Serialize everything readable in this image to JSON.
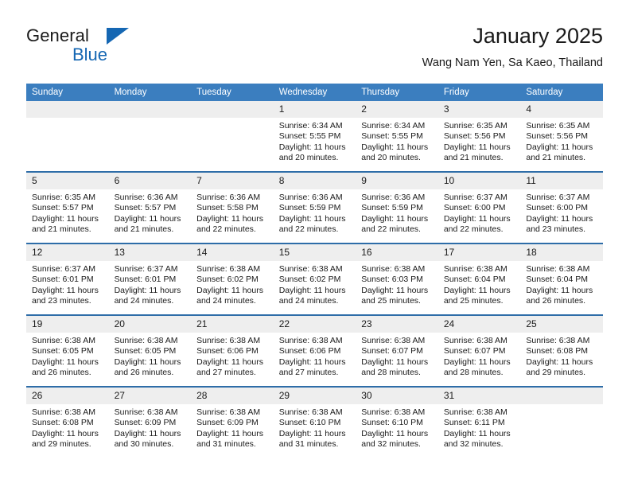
{
  "brand": {
    "name_part1": "General",
    "name_part2": "Blue",
    "logo_icon": "triangle-icon",
    "accent_color": "#1567b3"
  },
  "header": {
    "title": "January 2025",
    "subtitle": "Wang Nam Yen, Sa Kaeo, Thailand"
  },
  "calendar": {
    "header_bg": "#3b7ebf",
    "separator_color": "#2e6da8",
    "daynum_bg": "#eeeeee",
    "weekday_headers": [
      "Sunday",
      "Monday",
      "Tuesday",
      "Wednesday",
      "Thursday",
      "Friday",
      "Saturday"
    ],
    "weeks": [
      [
        {
          "day": "",
          "sunrise": "",
          "sunset": "",
          "daylight_line1": "",
          "daylight_line2": ""
        },
        {
          "day": "",
          "sunrise": "",
          "sunset": "",
          "daylight_line1": "",
          "daylight_line2": ""
        },
        {
          "day": "",
          "sunrise": "",
          "sunset": "",
          "daylight_line1": "",
          "daylight_line2": ""
        },
        {
          "day": "1",
          "sunrise": "Sunrise: 6:34 AM",
          "sunset": "Sunset: 5:55 PM",
          "daylight_line1": "Daylight: 11 hours",
          "daylight_line2": "and 20 minutes."
        },
        {
          "day": "2",
          "sunrise": "Sunrise: 6:34 AM",
          "sunset": "Sunset: 5:55 PM",
          "daylight_line1": "Daylight: 11 hours",
          "daylight_line2": "and 20 minutes."
        },
        {
          "day": "3",
          "sunrise": "Sunrise: 6:35 AM",
          "sunset": "Sunset: 5:56 PM",
          "daylight_line1": "Daylight: 11 hours",
          "daylight_line2": "and 21 minutes."
        },
        {
          "day": "4",
          "sunrise": "Sunrise: 6:35 AM",
          "sunset": "Sunset: 5:56 PM",
          "daylight_line1": "Daylight: 11 hours",
          "daylight_line2": "and 21 minutes."
        }
      ],
      [
        {
          "day": "5",
          "sunrise": "Sunrise: 6:35 AM",
          "sunset": "Sunset: 5:57 PM",
          "daylight_line1": "Daylight: 11 hours",
          "daylight_line2": "and 21 minutes."
        },
        {
          "day": "6",
          "sunrise": "Sunrise: 6:36 AM",
          "sunset": "Sunset: 5:57 PM",
          "daylight_line1": "Daylight: 11 hours",
          "daylight_line2": "and 21 minutes."
        },
        {
          "day": "7",
          "sunrise": "Sunrise: 6:36 AM",
          "sunset": "Sunset: 5:58 PM",
          "daylight_line1": "Daylight: 11 hours",
          "daylight_line2": "and 22 minutes."
        },
        {
          "day": "8",
          "sunrise": "Sunrise: 6:36 AM",
          "sunset": "Sunset: 5:59 PM",
          "daylight_line1": "Daylight: 11 hours",
          "daylight_line2": "and 22 minutes."
        },
        {
          "day": "9",
          "sunrise": "Sunrise: 6:36 AM",
          "sunset": "Sunset: 5:59 PM",
          "daylight_line1": "Daylight: 11 hours",
          "daylight_line2": "and 22 minutes."
        },
        {
          "day": "10",
          "sunrise": "Sunrise: 6:37 AM",
          "sunset": "Sunset: 6:00 PM",
          "daylight_line1": "Daylight: 11 hours",
          "daylight_line2": "and 22 minutes."
        },
        {
          "day": "11",
          "sunrise": "Sunrise: 6:37 AM",
          "sunset": "Sunset: 6:00 PM",
          "daylight_line1": "Daylight: 11 hours",
          "daylight_line2": "and 23 minutes."
        }
      ],
      [
        {
          "day": "12",
          "sunrise": "Sunrise: 6:37 AM",
          "sunset": "Sunset: 6:01 PM",
          "daylight_line1": "Daylight: 11 hours",
          "daylight_line2": "and 23 minutes."
        },
        {
          "day": "13",
          "sunrise": "Sunrise: 6:37 AM",
          "sunset": "Sunset: 6:01 PM",
          "daylight_line1": "Daylight: 11 hours",
          "daylight_line2": "and 24 minutes."
        },
        {
          "day": "14",
          "sunrise": "Sunrise: 6:38 AM",
          "sunset": "Sunset: 6:02 PM",
          "daylight_line1": "Daylight: 11 hours",
          "daylight_line2": "and 24 minutes."
        },
        {
          "day": "15",
          "sunrise": "Sunrise: 6:38 AM",
          "sunset": "Sunset: 6:02 PM",
          "daylight_line1": "Daylight: 11 hours",
          "daylight_line2": "and 24 minutes."
        },
        {
          "day": "16",
          "sunrise": "Sunrise: 6:38 AM",
          "sunset": "Sunset: 6:03 PM",
          "daylight_line1": "Daylight: 11 hours",
          "daylight_line2": "and 25 minutes."
        },
        {
          "day": "17",
          "sunrise": "Sunrise: 6:38 AM",
          "sunset": "Sunset: 6:04 PM",
          "daylight_line1": "Daylight: 11 hours",
          "daylight_line2": "and 25 minutes."
        },
        {
          "day": "18",
          "sunrise": "Sunrise: 6:38 AM",
          "sunset": "Sunset: 6:04 PM",
          "daylight_line1": "Daylight: 11 hours",
          "daylight_line2": "and 26 minutes."
        }
      ],
      [
        {
          "day": "19",
          "sunrise": "Sunrise: 6:38 AM",
          "sunset": "Sunset: 6:05 PM",
          "daylight_line1": "Daylight: 11 hours",
          "daylight_line2": "and 26 minutes."
        },
        {
          "day": "20",
          "sunrise": "Sunrise: 6:38 AM",
          "sunset": "Sunset: 6:05 PM",
          "daylight_line1": "Daylight: 11 hours",
          "daylight_line2": "and 26 minutes."
        },
        {
          "day": "21",
          "sunrise": "Sunrise: 6:38 AM",
          "sunset": "Sunset: 6:06 PM",
          "daylight_line1": "Daylight: 11 hours",
          "daylight_line2": "and 27 minutes."
        },
        {
          "day": "22",
          "sunrise": "Sunrise: 6:38 AM",
          "sunset": "Sunset: 6:06 PM",
          "daylight_line1": "Daylight: 11 hours",
          "daylight_line2": "and 27 minutes."
        },
        {
          "day": "23",
          "sunrise": "Sunrise: 6:38 AM",
          "sunset": "Sunset: 6:07 PM",
          "daylight_line1": "Daylight: 11 hours",
          "daylight_line2": "and 28 minutes."
        },
        {
          "day": "24",
          "sunrise": "Sunrise: 6:38 AM",
          "sunset": "Sunset: 6:07 PM",
          "daylight_line1": "Daylight: 11 hours",
          "daylight_line2": "and 28 minutes."
        },
        {
          "day": "25",
          "sunrise": "Sunrise: 6:38 AM",
          "sunset": "Sunset: 6:08 PM",
          "daylight_line1": "Daylight: 11 hours",
          "daylight_line2": "and 29 minutes."
        }
      ],
      [
        {
          "day": "26",
          "sunrise": "Sunrise: 6:38 AM",
          "sunset": "Sunset: 6:08 PM",
          "daylight_line1": "Daylight: 11 hours",
          "daylight_line2": "and 29 minutes."
        },
        {
          "day": "27",
          "sunrise": "Sunrise: 6:38 AM",
          "sunset": "Sunset: 6:09 PM",
          "daylight_line1": "Daylight: 11 hours",
          "daylight_line2": "and 30 minutes."
        },
        {
          "day": "28",
          "sunrise": "Sunrise: 6:38 AM",
          "sunset": "Sunset: 6:09 PM",
          "daylight_line1": "Daylight: 11 hours",
          "daylight_line2": "and 31 minutes."
        },
        {
          "day": "29",
          "sunrise": "Sunrise: 6:38 AM",
          "sunset": "Sunset: 6:10 PM",
          "daylight_line1": "Daylight: 11 hours",
          "daylight_line2": "and 31 minutes."
        },
        {
          "day": "30",
          "sunrise": "Sunrise: 6:38 AM",
          "sunset": "Sunset: 6:10 PM",
          "daylight_line1": "Daylight: 11 hours",
          "daylight_line2": "and 32 minutes."
        },
        {
          "day": "31",
          "sunrise": "Sunrise: 6:38 AM",
          "sunset": "Sunset: 6:11 PM",
          "daylight_line1": "Daylight: 11 hours",
          "daylight_line2": "and 32 minutes."
        },
        {
          "day": "",
          "sunrise": "",
          "sunset": "",
          "daylight_line1": "",
          "daylight_line2": ""
        }
      ]
    ]
  }
}
